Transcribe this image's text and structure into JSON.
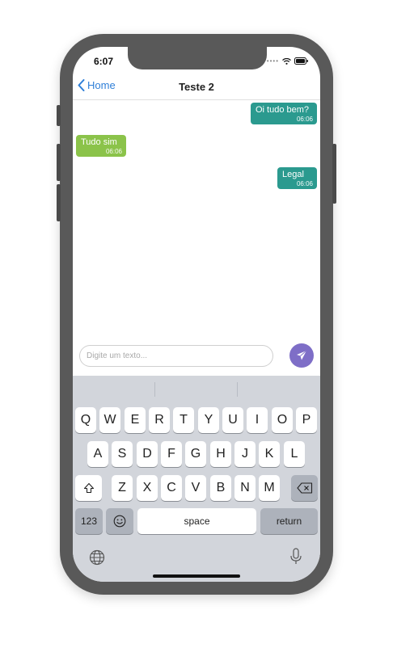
{
  "status_bar": {
    "time": "6:07"
  },
  "navbar": {
    "back_label": "Home",
    "title": "Teste 2"
  },
  "messages": [
    {
      "text": "Oi tudo bem?",
      "time": "06:06",
      "sender": "me",
      "color": "#2b9a8f"
    },
    {
      "text": "Tudo sim",
      "time": "06:06",
      "sender": "other",
      "color": "#8bc34a"
    },
    {
      "text": "Legal",
      "time": "06:06",
      "sender": "me",
      "color": "#2b9a8f"
    }
  ],
  "composer": {
    "placeholder": "Digite um texto...",
    "send_color": "#7e6ec7"
  },
  "keyboard": {
    "row1": [
      "Q",
      "W",
      "E",
      "R",
      "T",
      "Y",
      "U",
      "I",
      "O",
      "P"
    ],
    "row2": [
      "A",
      "S",
      "D",
      "F",
      "G",
      "H",
      "J",
      "K",
      "L"
    ],
    "row3": [
      "Z",
      "X",
      "C",
      "V",
      "B",
      "N",
      "M"
    ],
    "numbers_label": "123",
    "space_label": "space",
    "return_label": "return"
  }
}
